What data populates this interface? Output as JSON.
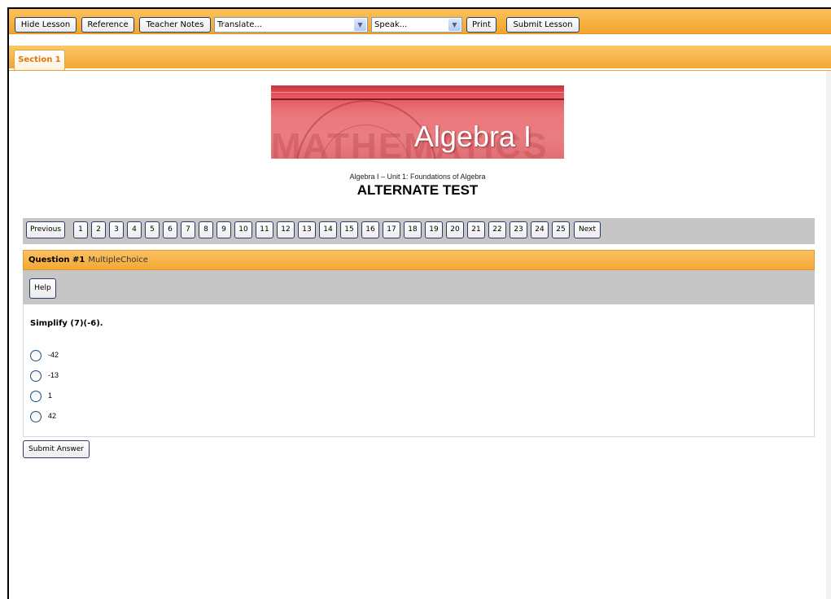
{
  "toolbar": {
    "hide_lesson": "Hide Lesson",
    "reference": "Reference",
    "teacher_notes": "Teacher Notes",
    "translate_value": "Translate...",
    "speak_value": "Speak...",
    "print": "Print",
    "submit_lesson": "Submit Lesson"
  },
  "tabs": [
    {
      "label": "Section 1",
      "selected": true
    }
  ],
  "banner": {
    "title": "Algebra I",
    "background_text": "MATHEMATICS"
  },
  "lesson": {
    "subtitle": "Algebra I – Unit 1: Foundations of Algebra",
    "title": "ALTERNATE TEST"
  },
  "nav": {
    "previous": "Previous",
    "next": "Next",
    "pages": [
      "1",
      "2",
      "3",
      "4",
      "5",
      "6",
      "7",
      "8",
      "9",
      "10",
      "11",
      "12",
      "13",
      "14",
      "15",
      "16",
      "17",
      "18",
      "19",
      "20",
      "21",
      "22",
      "23",
      "24",
      "25"
    ]
  },
  "question": {
    "number_label": "Question #1",
    "type": "MultipleChoice",
    "help": "Help",
    "prompt": "Simplify (7)(-6).",
    "options": [
      "-42",
      "-13",
      "1",
      "42"
    ],
    "submit": "Submit Answer"
  },
  "colors": {
    "toolbar_orange": "#f3a52c",
    "tab_text": "#e0760d",
    "button_border": "#2a3c68",
    "nav_gray": "#c6c6c6"
  }
}
